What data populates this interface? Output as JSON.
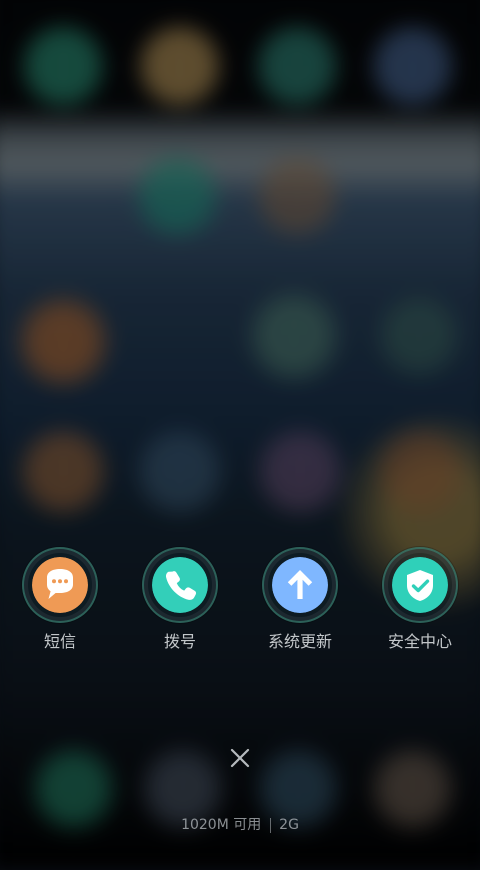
{
  "overlay": {
    "shortcuts": [
      {
        "label": "短信",
        "icon": "message-icon",
        "color": "#ef9a55"
      },
      {
        "label": "拨号",
        "icon": "phone-icon",
        "color": "#33cfb9"
      },
      {
        "label": "系统更新",
        "icon": "upload-arrow-icon",
        "color": "#7fb7ff"
      },
      {
        "label": "安全中心",
        "icon": "shield-check-icon",
        "color": "#2fd0b9"
      }
    ],
    "close_icon": "close-icon"
  },
  "status": {
    "memory": "1020M 可用",
    "network": "2G"
  },
  "colors": {
    "label_text": "#e6e9ec",
    "status_text": "#bec3c7"
  }
}
